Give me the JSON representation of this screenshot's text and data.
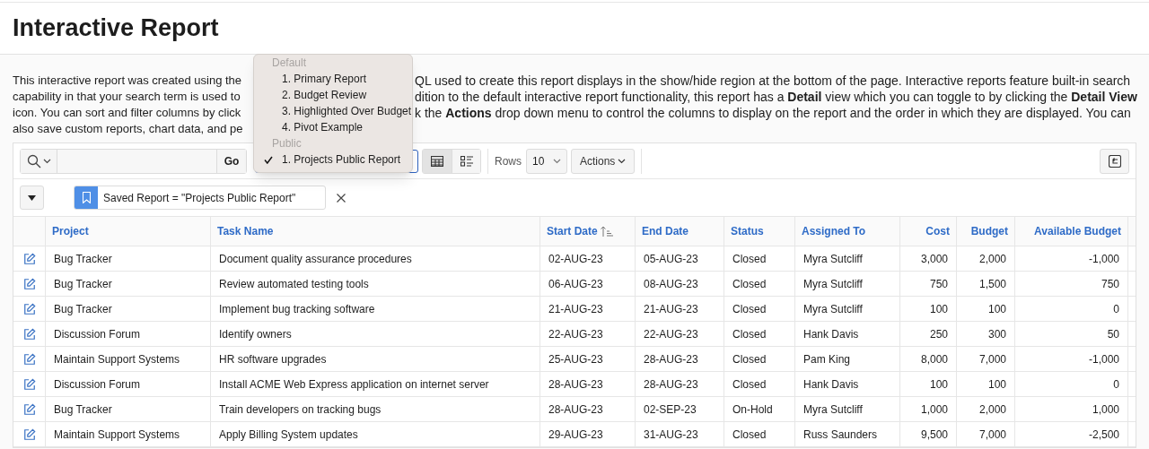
{
  "page_title": "Interactive Report",
  "description_lines": [
    {
      "left": "This interactive report was created using the",
      "right": "QL used to create this report displays in the show/hide region at the bottom of the page. Interactive reports feature built-in search"
    },
    {
      "left": "capability in that your search term is used to",
      "right": "dition to the default interactive report functionality, this report has a **Detail** view which you can toggle to by clicking the **Detail View**"
    },
    {
      "left": "icon. You can sort and filter columns by click",
      "right": "k the **Actions** drop down menu to control the columns to display on the report and the order in which they are displayed. You can"
    },
    {
      "left": "also save custom reports, chart data, and pe"
    }
  ],
  "toolbar": {
    "go": "Go",
    "rows_label": "Rows",
    "rows_value": "10",
    "actions": "Actions",
    "views": [
      {
        "kind": "grid",
        "selected": true
      },
      {
        "kind": "detail",
        "selected": false
      }
    ]
  },
  "report_menu": {
    "groups": [
      {
        "label": "Default",
        "items": [
          {
            "label": "1. Primary Report",
            "selected": false
          },
          {
            "label": "2. Budget Review",
            "selected": false
          },
          {
            "label": "3. Highlighted Over Budget",
            "selected": false
          },
          {
            "label": "4. Pivot Example",
            "selected": false
          }
        ]
      },
      {
        "label": "Public",
        "items": [
          {
            "label": "1. Projects Public Report",
            "selected": true
          }
        ]
      }
    ]
  },
  "filter": {
    "text": "Saved Report = \"Projects Public Report\""
  },
  "table": {
    "columns": [
      {
        "label": "Project",
        "kind": "text",
        "sorted": false
      },
      {
        "label": "Task Name",
        "kind": "text",
        "sorted": false
      },
      {
        "label": "Start Date",
        "kind": "text",
        "sorted": true
      },
      {
        "label": "End Date",
        "kind": "text",
        "sorted": false
      },
      {
        "label": "Status",
        "kind": "text",
        "sorted": false
      },
      {
        "label": "Assigned To",
        "kind": "text",
        "sorted": false
      },
      {
        "label": "Cost",
        "kind": "number",
        "sorted": false
      },
      {
        "label": "Budget",
        "kind": "number",
        "sorted": false
      },
      {
        "label": "Available Budget",
        "kind": "number",
        "sorted": false
      }
    ],
    "rows": [
      [
        "Bug Tracker",
        "Document quality assurance procedures",
        "02-AUG-23",
        "05-AUG-23",
        "Closed",
        "Myra Sutcliff",
        "3,000",
        "2,000",
        "-1,000"
      ],
      [
        "Bug Tracker",
        "Review automated testing tools",
        "06-AUG-23",
        "08-AUG-23",
        "Closed",
        "Myra Sutcliff",
        "750",
        "1,500",
        "750"
      ],
      [
        "Bug Tracker",
        "Implement bug tracking software",
        "21-AUG-23",
        "21-AUG-23",
        "Closed",
        "Myra Sutcliff",
        "100",
        "100",
        "0"
      ],
      [
        "Discussion Forum",
        "Identify owners",
        "22-AUG-23",
        "22-AUG-23",
        "Closed",
        "Hank Davis",
        "250",
        "300",
        "50"
      ],
      [
        "Maintain Support Systems",
        "HR software upgrades",
        "25-AUG-23",
        "28-AUG-23",
        "Closed",
        "Pam King",
        "8,000",
        "7,000",
        "-1,000"
      ],
      [
        "Discussion Forum",
        "Install ACME Web Express application on internet server",
        "28-AUG-23",
        "28-AUG-23",
        "Closed",
        "Hank Davis",
        "100",
        "100",
        "0"
      ],
      [
        "Bug Tracker",
        "Train developers on tracking bugs",
        "28-AUG-23",
        "02-SEP-23",
        "On-Hold",
        "Myra Sutcliff",
        "1,000",
        "2,000",
        "1,000"
      ],
      [
        "Maintain Support Systems",
        "Apply Billing System updates",
        "29-AUG-23",
        "31-AUG-23",
        "Closed",
        "Russ Saunders",
        "9,500",
        "7,000",
        "-2,500"
      ]
    ]
  }
}
